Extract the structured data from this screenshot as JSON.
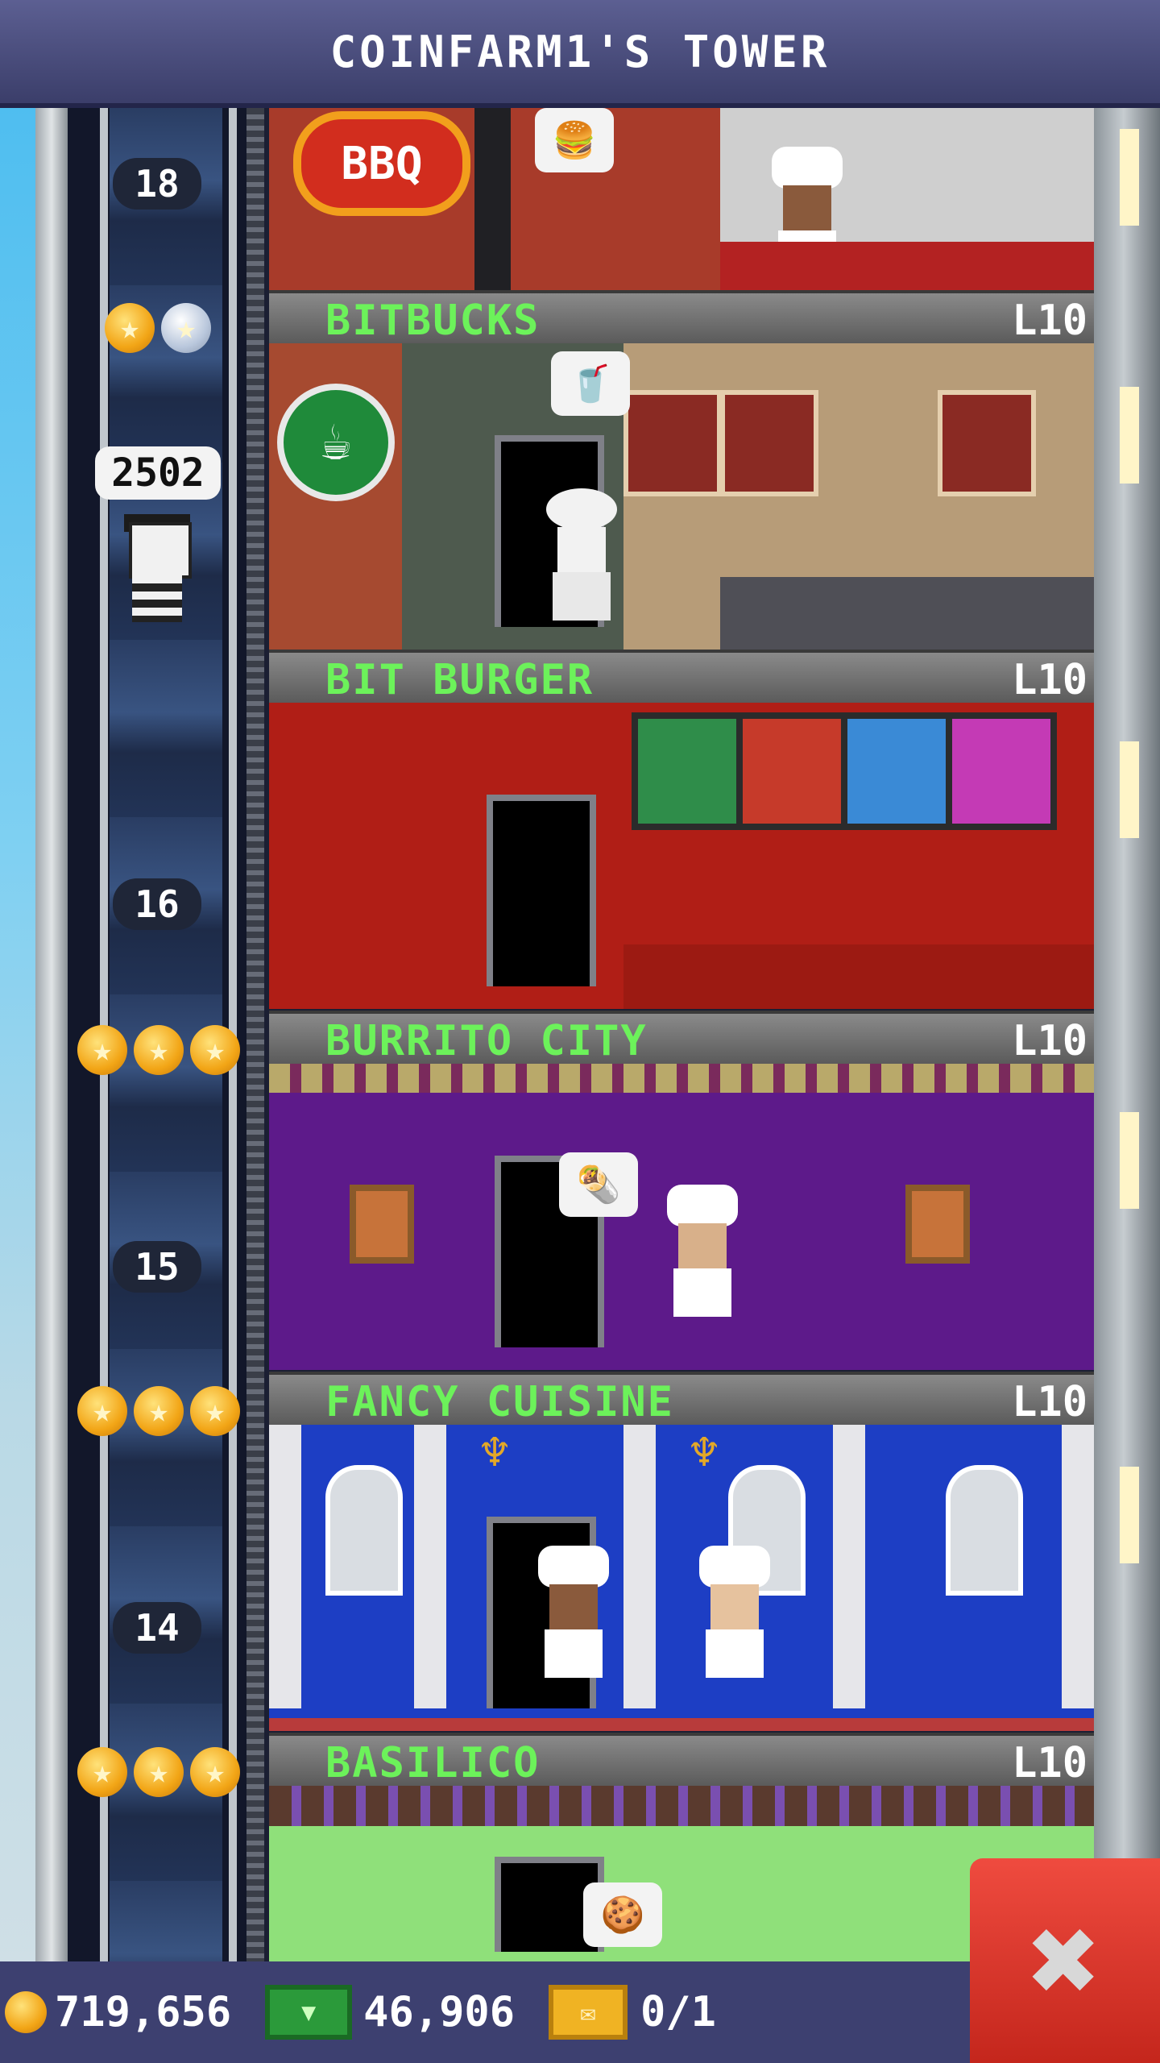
{
  "header": {
    "title": "COINFARM1'S TOWER"
  },
  "elevator": {
    "rider_count": "2502",
    "floor_numbers": [
      "18",
      "16",
      "15",
      "14"
    ]
  },
  "floors": [
    {
      "name": "",
      "level": "",
      "sign": "BBQ",
      "stars_gold": 0,
      "stars_silver": 0
    },
    {
      "name": "BITBUCKS",
      "level": "L10",
      "stars_gold": 1,
      "stars_silver": 1
    },
    {
      "name": "BIT BURGER",
      "level": "L10",
      "stars_gold": 0,
      "stars_silver": 0
    },
    {
      "name": "BURRITO CITY",
      "level": "L10",
      "stars_gold": 3,
      "stars_silver": 0
    },
    {
      "name": "FANCY CUISINE",
      "level": "L10",
      "stars_gold": 3,
      "stars_silver": 0
    },
    {
      "name": "BASILICO",
      "level": "L10",
      "stars_gold": 3,
      "stars_silver": 0
    }
  ],
  "resources": {
    "coins": "719,656",
    "bux": "46,906",
    "tickets": "0/1"
  },
  "colors": {
    "title_bar": "#4a4d80",
    "store_name": "#6cf25a",
    "close_button": "#e23b30"
  },
  "icons": {
    "coin": "coin-icon",
    "bux": "bux-icon",
    "ticket": "ticket-icon",
    "close": "close-icon"
  }
}
